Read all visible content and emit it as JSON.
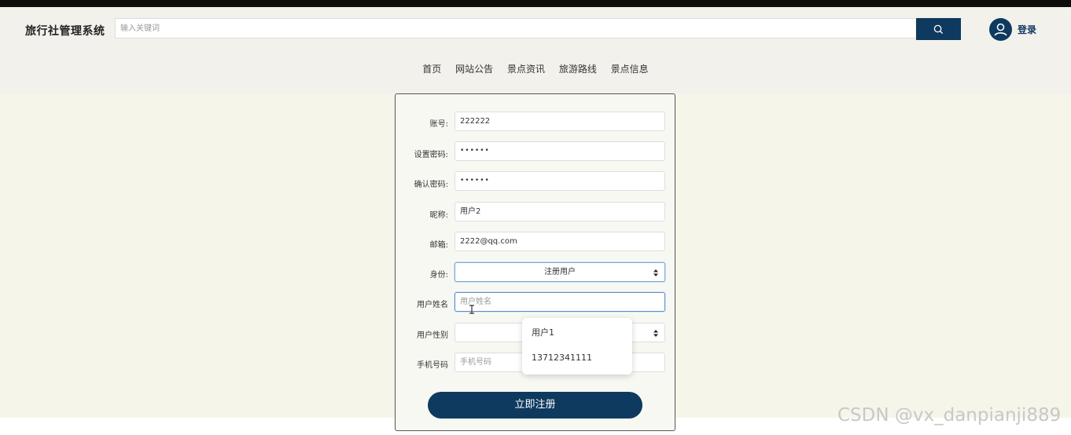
{
  "header": {
    "brand": "旅行社管理系统",
    "search_placeholder": "输入关键词",
    "login_label": "登录",
    "nav": [
      "首页",
      "网站公告",
      "景点资讯",
      "旅游路线",
      "景点信息"
    ]
  },
  "form": {
    "account_label": "账号:",
    "account_value": "222222",
    "password_label": "设置密码:",
    "password_value": "••••••",
    "confirm_label": "确认密码:",
    "confirm_value": "••••••",
    "nickname_label": "昵称:",
    "nickname_value": "用户2",
    "email_label": "邮箱:",
    "email_value": "2222@qq.com",
    "role_label": "身份:",
    "role_value": "注册用户",
    "realname_label": "用户姓名",
    "realname_placeholder": "用户姓名",
    "gender_label": "用户性别",
    "gender_value": "",
    "phone_label": "手机号码",
    "phone_placeholder": "手机号码",
    "submit_label": "立即注册"
  },
  "autocomplete": [
    "用户1",
    "13712341111"
  ],
  "watermark": "CSDN @vx_danpianji889",
  "colors": {
    "primary": "#0f3a5f",
    "header_bg": "#f3f1ec",
    "page_bg": "#f5f5ea"
  }
}
